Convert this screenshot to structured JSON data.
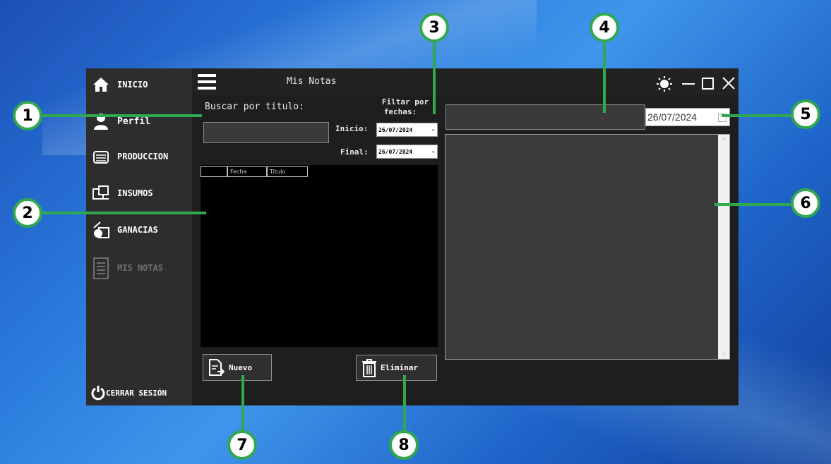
{
  "window": {
    "title": "Mis Notas"
  },
  "sidebar": {
    "items": [
      {
        "label": "INICIO",
        "icon": "home-icon"
      },
      {
        "label": "Perfil",
        "icon": "user-icon"
      },
      {
        "label": "PRODUCCION",
        "icon": "production-icon"
      },
      {
        "label": "INSUMOS",
        "icon": "supplies-icon"
      },
      {
        "label": "GANACIAS",
        "icon": "money-icon"
      },
      {
        "label": "MIS NOTAS",
        "icon": "notes-icon"
      }
    ],
    "logout_label": "CERRAR SESIÓN"
  },
  "search": {
    "label": "Buscar por titulo:",
    "value": ""
  },
  "filter": {
    "label_line1": "Filtar por",
    "label_line2": "fechas:",
    "start_label": "Inicio:",
    "start_value": "26/07/2024",
    "end_label": "Final:",
    "end_value": "26/07/2024"
  },
  "notes_table": {
    "columns": [
      "",
      "Fecha",
      "Titulo"
    ]
  },
  "editor": {
    "title_value": "",
    "date_value": "26/07/2024",
    "body_value": ""
  },
  "buttons": {
    "new_label": "Nuevo",
    "delete_label": "Eliminar"
  },
  "callouts": [
    "1",
    "2",
    "3",
    "4",
    "5",
    "6",
    "7",
    "8"
  ],
  "colors": {
    "callout_green": "#2fa84f",
    "window_bg": "#222222",
    "sidebar_bg": "#2d2d2d"
  }
}
